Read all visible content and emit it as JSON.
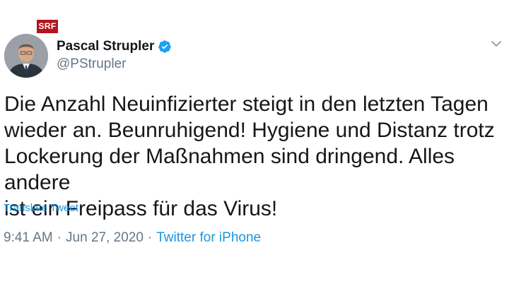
{
  "watermark": {
    "label": "SRF",
    "color": "#b3141d"
  },
  "author": {
    "display_name": "Pascal Strupler",
    "handle": "@PStrupler",
    "verified_icon": "verified-badge-icon",
    "verified_color": "#1da1f2"
  },
  "menu": {
    "icon": "chevron-down-icon"
  },
  "tweet": {
    "lines": [
      "Die Anzahl Neuinfizierter steigt in den letzten Tagen",
      "wieder an. Beunruhigend! Hygiene und Distanz trotz",
      "Lockerung der Maßnahmen sind dringend. Alles andere",
      "ist ein Freipass für das Virus!"
    ],
    "translate_label": "Translate Tweet"
  },
  "meta": {
    "time": "9:41 AM",
    "separator": "·",
    "date": "Jun 27, 2020",
    "source": "Twitter for iPhone"
  },
  "colors": {
    "link": "#1b95e0",
    "secondary_text": "#657786",
    "primary_text": "#14171a"
  }
}
